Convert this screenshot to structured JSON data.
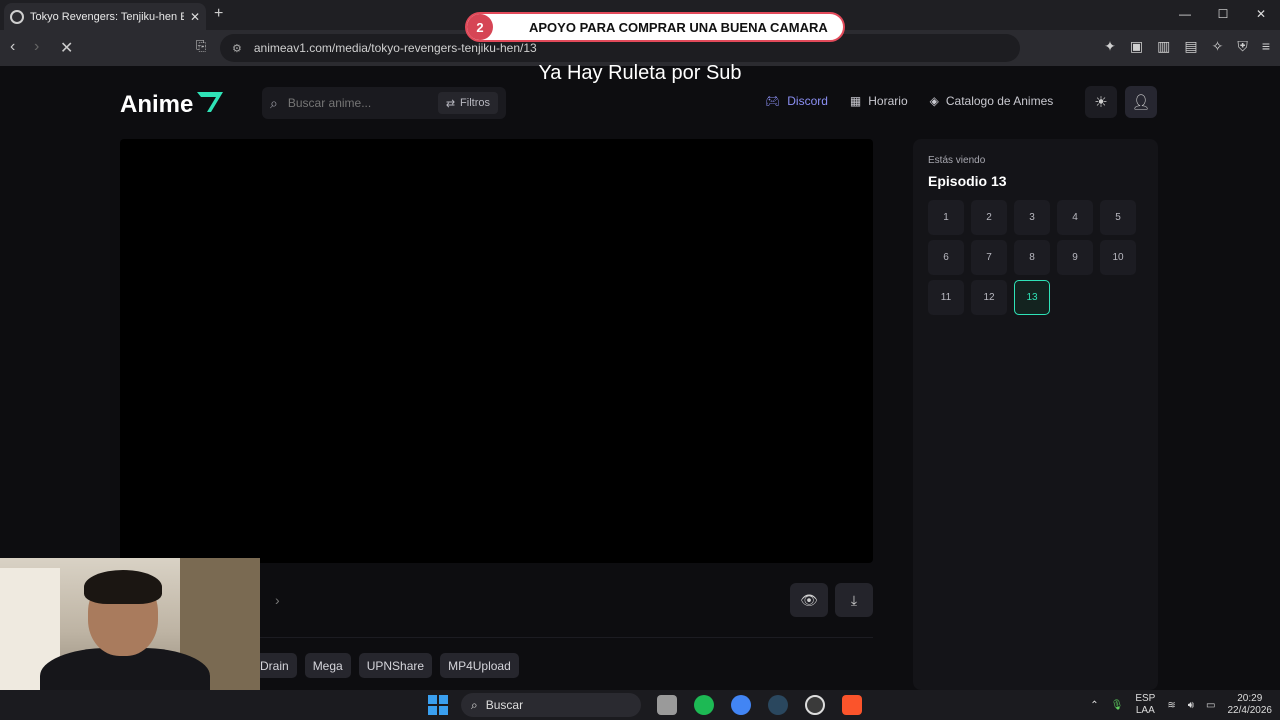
{
  "browser": {
    "tab_title": "Tokyo Revengers: Tenjiku-hen Ep",
    "url": "animeav1.com/media/tokyo-revengers-tenjiku-hen/13"
  },
  "banner": {
    "count": "2",
    "text": "APOYO PARA COMPRAR UNA BUENA CAMARA"
  },
  "overlay_text": "Ya Hay Ruleta por Sub",
  "site": {
    "logo_text": "Anime",
    "search_placeholder": "Buscar anime...",
    "filters_label": "Filtros",
    "nav": {
      "discord": "Discord",
      "schedule": "Horario",
      "catalog": "Catalogo de Animes"
    }
  },
  "servers": [
    "Drain",
    "Mega",
    "UPNShare",
    "MP4Upload"
  ],
  "episodes_panel": {
    "subtitle": "Estás viendo",
    "current_title": "Episodio 13",
    "episodes": [
      "1",
      "2",
      "3",
      "4",
      "5",
      "6",
      "7",
      "8",
      "9",
      "10",
      "11",
      "12",
      "13"
    ],
    "active_episode": "13"
  },
  "taskbar": {
    "search_label": "Buscar",
    "lang_top": "ESP",
    "lang_bottom": "LAA",
    "time": "20:29",
    "date": "22/4/2026"
  },
  "colors": {
    "accent": "#2fe3b7",
    "discord": "#8b8ff3",
    "banner_red": "#d64555"
  }
}
